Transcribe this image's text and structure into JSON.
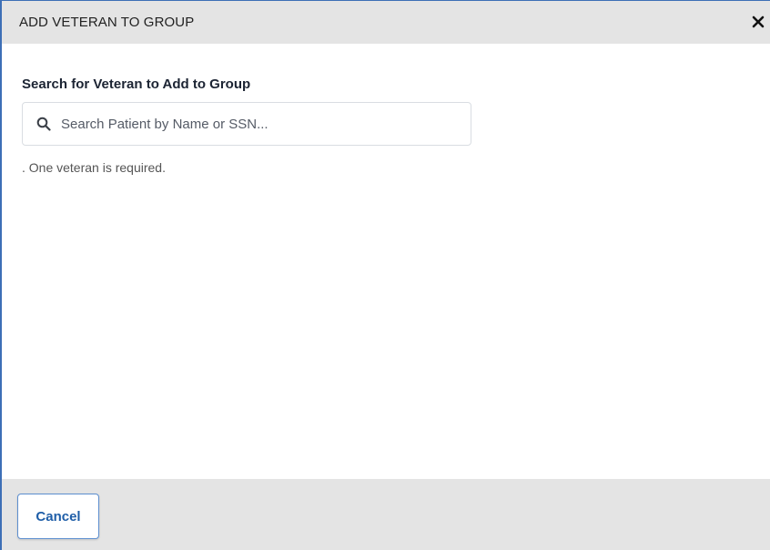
{
  "dialog": {
    "title": "ADD VETERAN TO GROUP",
    "close_label": "✕"
  },
  "search": {
    "label": "Search for Veteran to Add to Group",
    "placeholder": "Search Patient by Name or SSN...",
    "value": "",
    "icon": "search-icon"
  },
  "validation": {
    "message": ". One veteran is required."
  },
  "footer": {
    "cancel_label": "Cancel"
  },
  "colors": {
    "header_bg": "#e4e4e4",
    "accent": "#1f5ea8",
    "border": "#3d6fb6"
  }
}
